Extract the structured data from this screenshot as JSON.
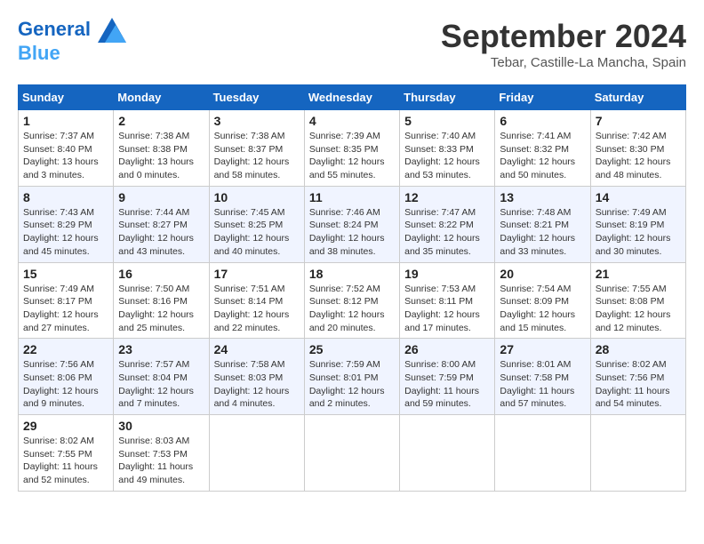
{
  "logo": {
    "line1": "General",
    "line2": "Blue"
  },
  "title": "September 2024",
  "location": "Tebar, Castille-La Mancha, Spain",
  "days_of_week": [
    "Sunday",
    "Monday",
    "Tuesday",
    "Wednesday",
    "Thursday",
    "Friday",
    "Saturday"
  ],
  "weeks": [
    [
      {
        "day": 1,
        "sunrise": "7:37 AM",
        "sunset": "8:40 PM",
        "daylight": "13 hours and 3 minutes."
      },
      {
        "day": 2,
        "sunrise": "7:38 AM",
        "sunset": "8:38 PM",
        "daylight": "13 hours and 0 minutes."
      },
      {
        "day": 3,
        "sunrise": "7:38 AM",
        "sunset": "8:37 PM",
        "daylight": "12 hours and 58 minutes."
      },
      {
        "day": 4,
        "sunrise": "7:39 AM",
        "sunset": "8:35 PM",
        "daylight": "12 hours and 55 minutes."
      },
      {
        "day": 5,
        "sunrise": "7:40 AM",
        "sunset": "8:33 PM",
        "daylight": "12 hours and 53 minutes."
      },
      {
        "day": 6,
        "sunrise": "7:41 AM",
        "sunset": "8:32 PM",
        "daylight": "12 hours and 50 minutes."
      },
      {
        "day": 7,
        "sunrise": "7:42 AM",
        "sunset": "8:30 PM",
        "daylight": "12 hours and 48 minutes."
      }
    ],
    [
      {
        "day": 8,
        "sunrise": "7:43 AM",
        "sunset": "8:29 PM",
        "daylight": "12 hours and 45 minutes."
      },
      {
        "day": 9,
        "sunrise": "7:44 AM",
        "sunset": "8:27 PM",
        "daylight": "12 hours and 43 minutes."
      },
      {
        "day": 10,
        "sunrise": "7:45 AM",
        "sunset": "8:25 PM",
        "daylight": "12 hours and 40 minutes."
      },
      {
        "day": 11,
        "sunrise": "7:46 AM",
        "sunset": "8:24 PM",
        "daylight": "12 hours and 38 minutes."
      },
      {
        "day": 12,
        "sunrise": "7:47 AM",
        "sunset": "8:22 PM",
        "daylight": "12 hours and 35 minutes."
      },
      {
        "day": 13,
        "sunrise": "7:48 AM",
        "sunset": "8:21 PM",
        "daylight": "12 hours and 33 minutes."
      },
      {
        "day": 14,
        "sunrise": "7:49 AM",
        "sunset": "8:19 PM",
        "daylight": "12 hours and 30 minutes."
      }
    ],
    [
      {
        "day": 15,
        "sunrise": "7:49 AM",
        "sunset": "8:17 PM",
        "daylight": "12 hours and 27 minutes."
      },
      {
        "day": 16,
        "sunrise": "7:50 AM",
        "sunset": "8:16 PM",
        "daylight": "12 hours and 25 minutes."
      },
      {
        "day": 17,
        "sunrise": "7:51 AM",
        "sunset": "8:14 PM",
        "daylight": "12 hours and 22 minutes."
      },
      {
        "day": 18,
        "sunrise": "7:52 AM",
        "sunset": "8:12 PM",
        "daylight": "12 hours and 20 minutes."
      },
      {
        "day": 19,
        "sunrise": "7:53 AM",
        "sunset": "8:11 PM",
        "daylight": "12 hours and 17 minutes."
      },
      {
        "day": 20,
        "sunrise": "7:54 AM",
        "sunset": "8:09 PM",
        "daylight": "12 hours and 15 minutes."
      },
      {
        "day": 21,
        "sunrise": "7:55 AM",
        "sunset": "8:08 PM",
        "daylight": "12 hours and 12 minutes."
      }
    ],
    [
      {
        "day": 22,
        "sunrise": "7:56 AM",
        "sunset": "8:06 PM",
        "daylight": "12 hours and 9 minutes."
      },
      {
        "day": 23,
        "sunrise": "7:57 AM",
        "sunset": "8:04 PM",
        "daylight": "12 hours and 7 minutes."
      },
      {
        "day": 24,
        "sunrise": "7:58 AM",
        "sunset": "8:03 PM",
        "daylight": "12 hours and 4 minutes."
      },
      {
        "day": 25,
        "sunrise": "7:59 AM",
        "sunset": "8:01 PM",
        "daylight": "12 hours and 2 minutes."
      },
      {
        "day": 26,
        "sunrise": "8:00 AM",
        "sunset": "7:59 PM",
        "daylight": "11 hours and 59 minutes."
      },
      {
        "day": 27,
        "sunrise": "8:01 AM",
        "sunset": "7:58 PM",
        "daylight": "11 hours and 57 minutes."
      },
      {
        "day": 28,
        "sunrise": "8:02 AM",
        "sunset": "7:56 PM",
        "daylight": "11 hours and 54 minutes."
      }
    ],
    [
      {
        "day": 29,
        "sunrise": "8:02 AM",
        "sunset": "7:55 PM",
        "daylight": "11 hours and 52 minutes."
      },
      {
        "day": 30,
        "sunrise": "8:03 AM",
        "sunset": "7:53 PM",
        "daylight": "11 hours and 49 minutes."
      },
      null,
      null,
      null,
      null,
      null
    ]
  ]
}
